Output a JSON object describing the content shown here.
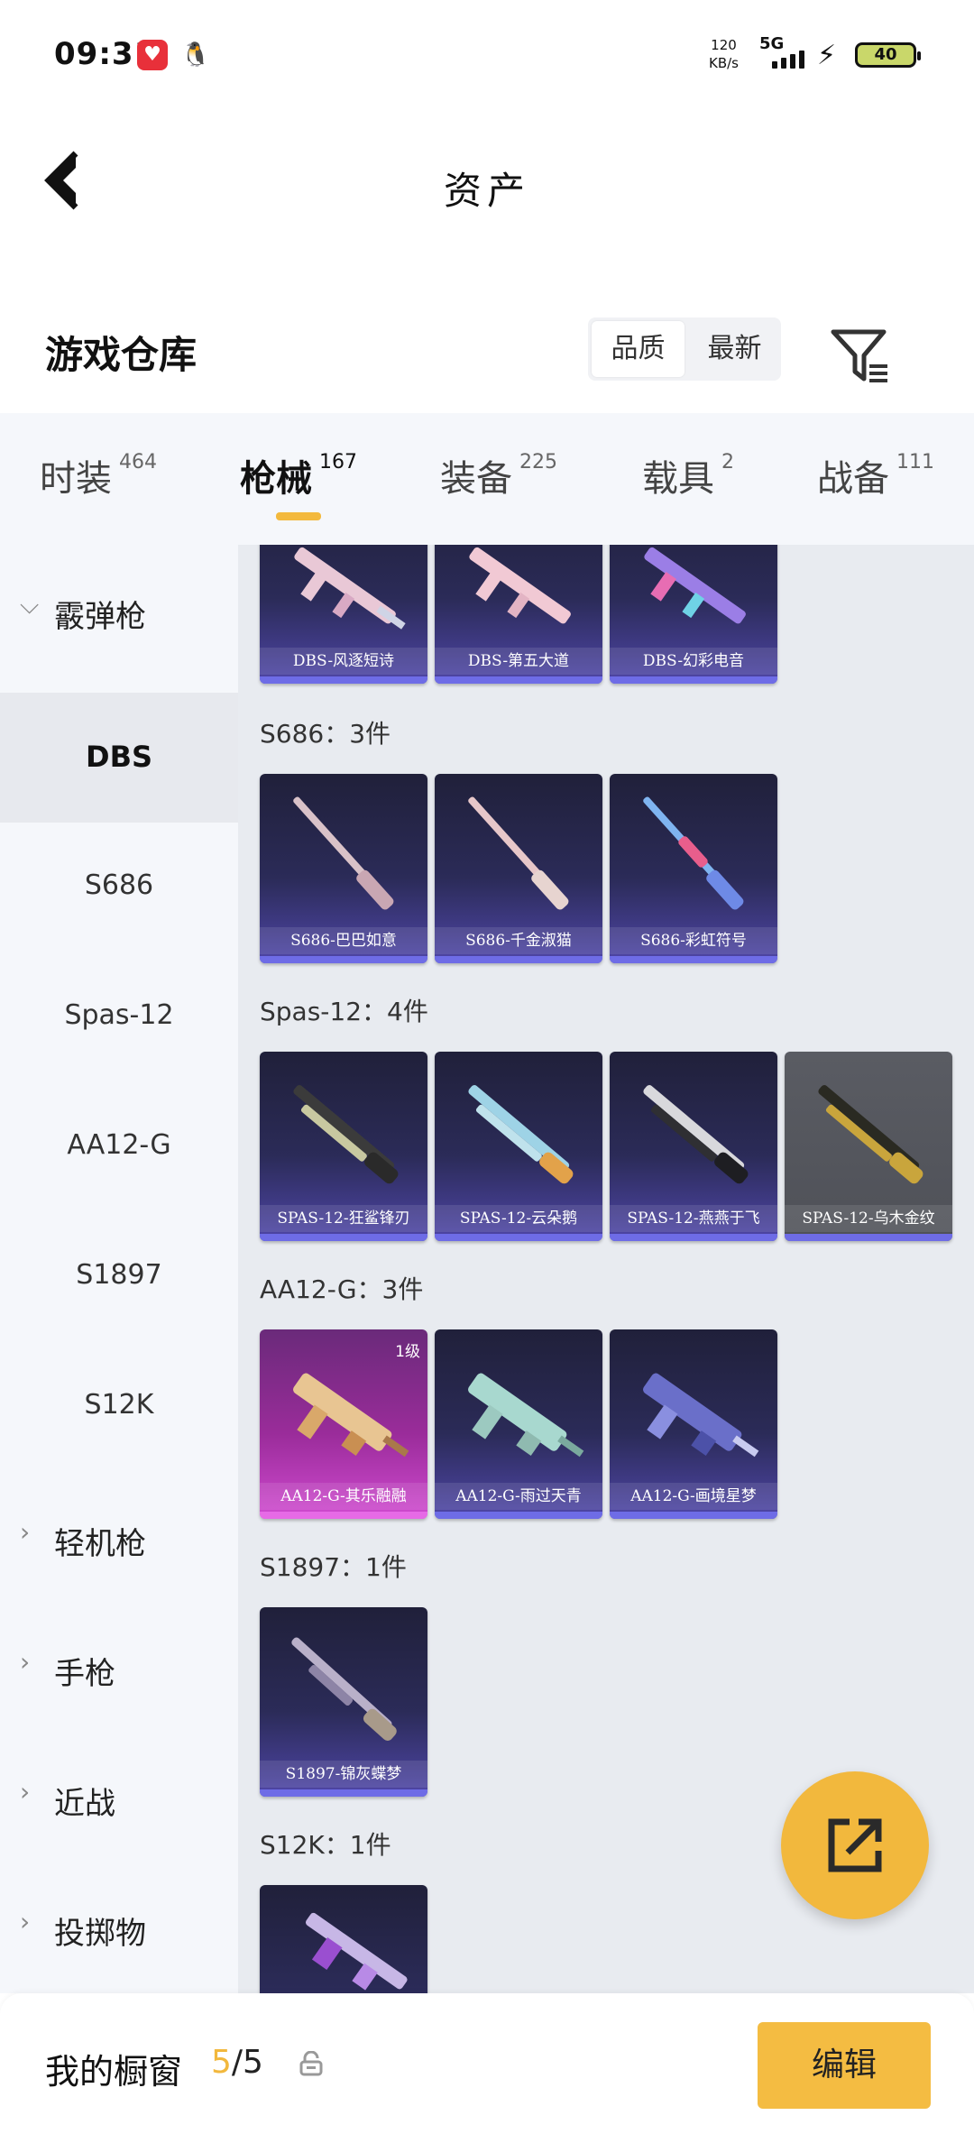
{
  "status": {
    "time": "09:31",
    "net_speed_value": "120",
    "net_speed_unit": "KB/s",
    "net_type": "5G",
    "battery": "40"
  },
  "header": {
    "title": "资产"
  },
  "warehouse": {
    "title": "游戏仓库",
    "sort_options": [
      "品质",
      "最新"
    ],
    "active_sort": "品质"
  },
  "tabs": [
    {
      "label": "时装",
      "count": "464"
    },
    {
      "label": "枪械",
      "count": "167"
    },
    {
      "label": "装备",
      "count": "225"
    },
    {
      "label": "载具",
      "count": "2"
    },
    {
      "label": "战备",
      "count": "111"
    }
  ],
  "active_tab": "枪械",
  "sidebar": {
    "groups": [
      {
        "label": "霰弹枪",
        "expanded": true
      },
      {
        "label": "轻机枪",
        "expanded": false
      },
      {
        "label": "手枪",
        "expanded": false
      },
      {
        "label": "近战",
        "expanded": false
      },
      {
        "label": "投掷物",
        "expanded": false
      }
    ],
    "subitems": [
      "DBS",
      "S686",
      "Spas-12",
      "AA12-G",
      "S1897",
      "S12K"
    ],
    "selected": "DBS"
  },
  "content": {
    "groups": [
      {
        "label": "",
        "items": [
          "DBS-风逐短诗",
          "DBS-第五大道",
          "DBS-幻彩电音"
        ]
      },
      {
        "label": "S686：3件",
        "items": [
          "S686-巴巴如意",
          "S686-千金淑猫",
          "S686-彩虹符号"
        ]
      },
      {
        "label": "Spas-12：4件",
        "items": [
          "SPAS-12-狂鲨锋刃",
          "SPAS-12-云朵鹅",
          "SPAS-12-燕燕于飞",
          "SPAS-12-乌木金纹"
        ]
      },
      {
        "label": "AA12-G：3件",
        "items": [
          "AA12-G-其乐融融",
          "AA12-G-雨过天青",
          "AA12-G-画境星梦"
        ],
        "level_badge": "1级"
      },
      {
        "label": "S1897：1件",
        "items": [
          "S1897-锦灰蝶梦"
        ]
      },
      {
        "label": "S12K：1件",
        "items": [
          ""
        ]
      }
    ]
  },
  "bottom": {
    "showcase_label": "我的橱窗",
    "showcase_current": "5",
    "showcase_sep": "/",
    "showcase_total": "5",
    "edit_label": "编辑"
  },
  "colors": {
    "accent": "#f2b83d",
    "card_purple": "#4f46a8",
    "card_pink": "#d04ad0",
    "card_gray": "#55575e"
  },
  "icons": [
    "back-arrow-icon",
    "filter-icon",
    "chevron-down-icon",
    "chevron-right-icon",
    "share-icon",
    "lock-icon"
  ]
}
